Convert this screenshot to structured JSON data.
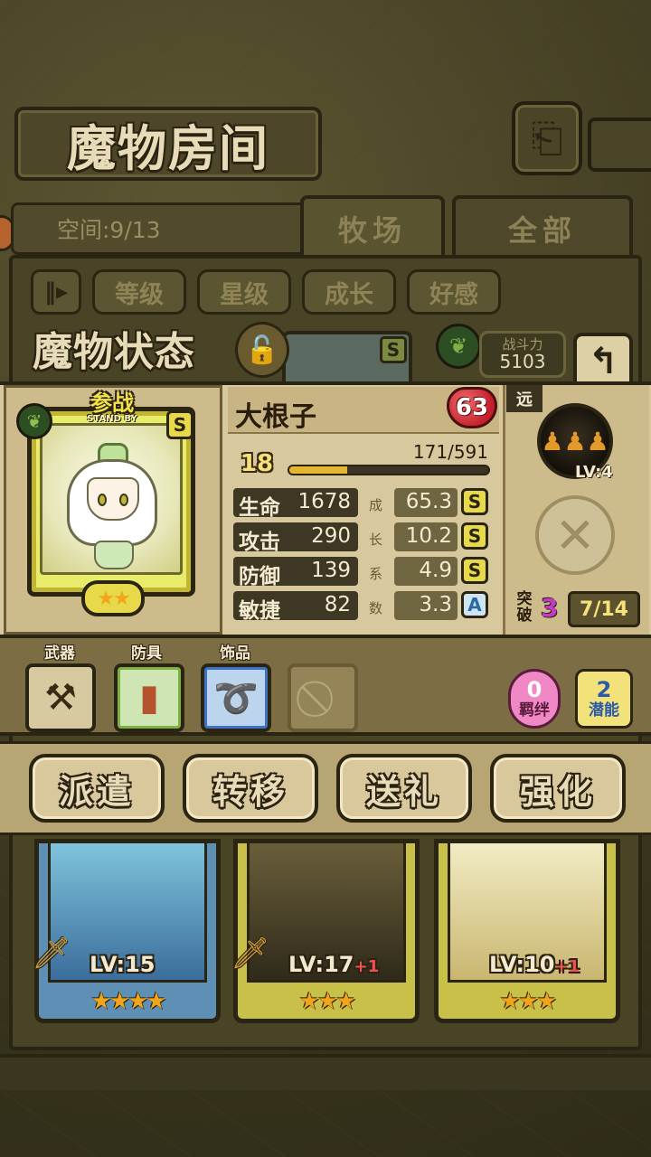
{
  "header": {
    "title": "魔物房间",
    "back_icon": "return-arrow-icon"
  },
  "capacity": {
    "text": "空间:9/13"
  },
  "tabs": [
    {
      "label": "牧场",
      "active": true
    },
    {
      "label": "全部",
      "active": false
    }
  ],
  "sort": {
    "pause_icon": "‖▸",
    "buttons": [
      "等级",
      "星级",
      "成长",
      "好感"
    ]
  },
  "status": {
    "title": "魔物状态",
    "power_label": "战斗力",
    "power_value": "5103"
  },
  "monster": {
    "name": "大根子",
    "standby_cn": "参战",
    "standby_en": "STAND BY",
    "rank": "S",
    "stars": "★★",
    "favor": "63",
    "level": "18",
    "exp_text": "171/591",
    "exp_fraction": 0.29,
    "stats": [
      {
        "label": "生命",
        "value": "1678",
        "growth": "65.3",
        "grade": "S",
        "growth_char": "成"
      },
      {
        "label": "攻击",
        "value": "290",
        "growth": "10.2",
        "grade": "S",
        "growth_char": "长"
      },
      {
        "label": "防御",
        "value": "139",
        "growth": "4.9",
        "grade": "S",
        "growth_char": "系"
      },
      {
        "label": "敏捷",
        "value": "82",
        "growth": "3.3",
        "grade": "A",
        "growth_char": "数"
      }
    ]
  },
  "side": {
    "range_tag": "远",
    "skill_level": "LV:4",
    "break_label": "突破",
    "break_count": "3",
    "break_progress": "7/14"
  },
  "equipment": {
    "weapon_label": "武器",
    "armor_label": "防具",
    "accessory_label": "饰品",
    "bond_count": "0",
    "bond_label": "羁绊",
    "potential_count": "2",
    "potential_label": "潜能"
  },
  "actions": [
    "派遣",
    "转移",
    "送礼",
    "强化"
  ],
  "roster": [
    {
      "lv": "LV:15",
      "plus": "",
      "stars": "★★★★"
    },
    {
      "lv": "LV:17",
      "plus": "+1",
      "stars": "★★★"
    },
    {
      "lv": "LV:10",
      "plus": "+1",
      "stars": "★★★"
    }
  ],
  "colors": {
    "parchment": "#d8c89d",
    "accent_gold": "#e7d94a",
    "break_purple": "#c23cc4"
  }
}
